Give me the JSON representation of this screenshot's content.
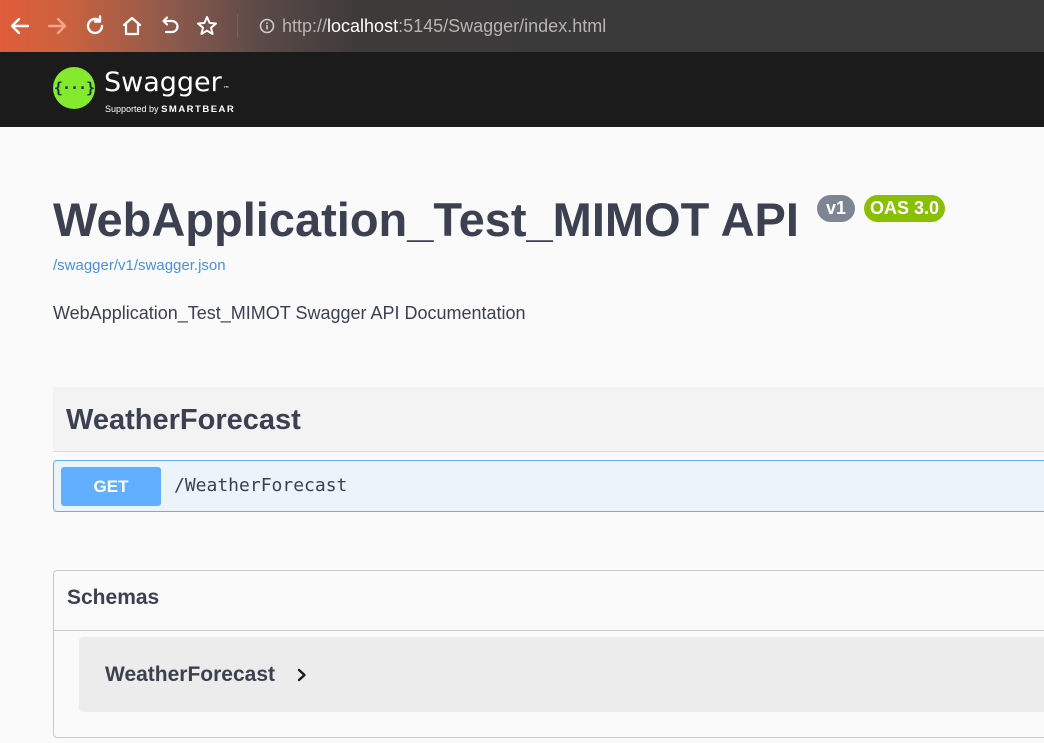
{
  "browser": {
    "url_scheme": "http://",
    "url_host": "localhost",
    "url_rest": ":5145/Swagger/index.html",
    "icons": [
      "back-arrow-icon",
      "forward-arrow-icon",
      "reload-icon",
      "home-icon",
      "undo-icon",
      "bookmark-star-icon",
      "info-icon"
    ]
  },
  "topbar": {
    "logo_symbol": "{···}",
    "brand_name": "Swagger",
    "trademark": "™",
    "supported_by": "Supported by",
    "smartbear": "SMARTBEAR"
  },
  "info": {
    "title": "WebApplication_Test_MIMOT API",
    "version": "v1",
    "oas_version": "OAS 3.0",
    "spec_link": "/swagger/v1/swagger.json",
    "description": "WebApplication_Test_MIMOT Swagger API Documentation"
  },
  "tags": [
    {
      "name": "WeatherForecast",
      "operations": [
        {
          "method": "GET",
          "path": "/WeatherForecast"
        }
      ]
    }
  ],
  "schemas": {
    "title": "Schemas",
    "models": [
      {
        "name": "WeatherForecast"
      }
    ]
  },
  "colors": {
    "get_method": "#61affe",
    "oas_badge": "#89bf04",
    "version_badge": "#7d8492",
    "swagger_green": "#85ea2d",
    "link": "#4990e2"
  }
}
